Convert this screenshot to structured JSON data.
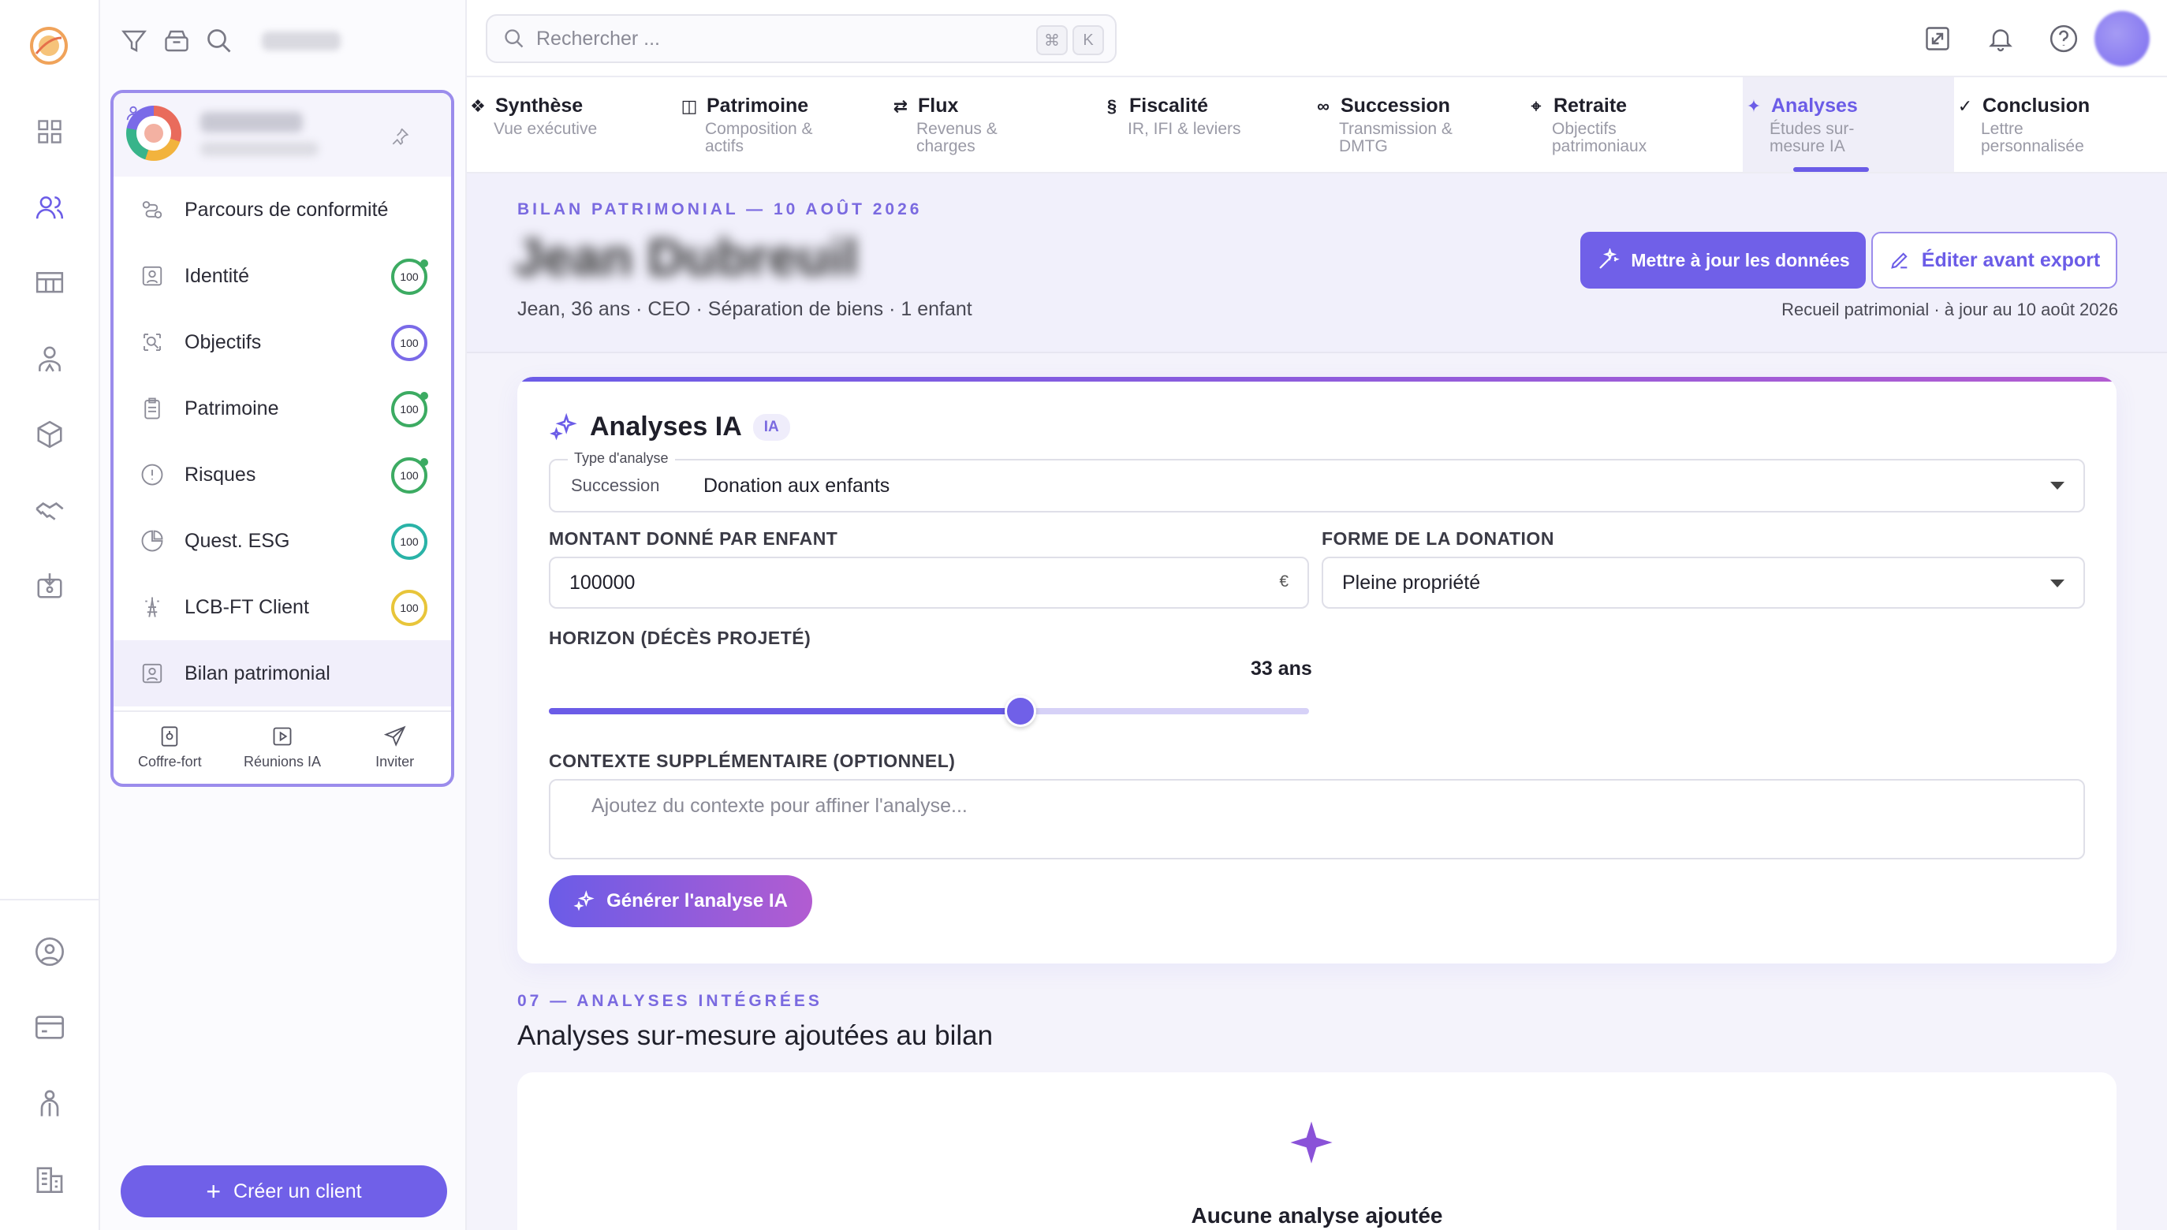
{
  "colors": {
    "accent": "#6b5ce7",
    "accent_gradient_end": "#b25cd1",
    "score_green": "#3cab62",
    "score_purple": "#7a6ae8",
    "score_teal": "#2ab3a7",
    "score_yellow": "#e8c53a"
  },
  "rail": {
    "icons": [
      "app-logo",
      "dashboard-grid-icon",
      "clients-icon",
      "table-icon",
      "advisor-icon",
      "products-cube-icon",
      "handshake-icon",
      "inbox-download-icon",
      "account-circle-icon",
      "billing-card-icon",
      "team-icon",
      "building-icon"
    ],
    "active": "clients-icon"
  },
  "client_panel": {
    "items": [
      {
        "label": "Parcours de conformité",
        "icon": "compliance-route-icon"
      },
      {
        "label": "Identité",
        "icon": "identity-icon",
        "score": "100",
        "score_color": "#3cab62",
        "dot": true
      },
      {
        "label": "Objectifs",
        "icon": "target-icon",
        "score": "100",
        "score_color": "#7a6ae8"
      },
      {
        "label": "Patrimoine",
        "icon": "clipboard-icon",
        "score": "100",
        "score_color": "#3cab62",
        "dot": true
      },
      {
        "label": "Risques",
        "icon": "alert-circle-icon",
        "score": "100",
        "score_color": "#3cab62",
        "dot": true
      },
      {
        "label": "Quest. ESG",
        "icon": "pie-chart-icon",
        "score": "100",
        "score_color": "#2ab3a7"
      },
      {
        "label": "LCB-FT Client",
        "icon": "tower-icon",
        "score": "100",
        "score_color": "#e8c53a"
      },
      {
        "label": "Bilan patrimonial",
        "icon": "report-icon",
        "selected": true
      }
    ],
    "footer": [
      {
        "label": "Coffre-fort",
        "icon": "safe-icon"
      },
      {
        "label": "Réunions IA",
        "icon": "video-play-icon"
      },
      {
        "label": "Inviter",
        "icon": "send-icon"
      }
    ],
    "new_client_label": "Créer un client"
  },
  "topbar": {
    "search_placeholder": "Rechercher ...",
    "kbd_cmd": "⌘",
    "kbd_k": "K"
  },
  "tabs": [
    {
      "title": "Synthèse",
      "sub": "Vue exécutive",
      "icon": "❖"
    },
    {
      "title": "Patrimoine",
      "sub": "Composition & actifs",
      "icon": "◫"
    },
    {
      "title": "Flux",
      "sub": "Revenus & charges",
      "icon": "⇄"
    },
    {
      "title": "Fiscalité",
      "sub": "IR, IFI & leviers",
      "icon": "§"
    },
    {
      "title": "Succession",
      "sub": "Transmission & DMTG",
      "icon": "∞"
    },
    {
      "title": "Retraite",
      "sub": "Objectifs patrimoniaux",
      "icon": "⌖"
    },
    {
      "title": "Analyses",
      "sub": "Études sur-mesure IA",
      "icon": "✦",
      "active": true
    },
    {
      "title": "Conclusion",
      "sub": "Lettre personnalisée",
      "icon": "✓"
    }
  ],
  "header": {
    "eyebrow": "BILAN PATRIMONIAL — 10 AOÛT 2026",
    "client_name": "Jean Dubreuil",
    "meta": "Jean, 36 ans · CEO · Séparation de biens · 1 enfant",
    "update_label": "Mettre à jour les données",
    "edit_label": "Éditer avant export",
    "updated": "Recueil patrimonial · à jour au 10 août 2026"
  },
  "analysis": {
    "title": "Analyses IA",
    "badge": "IA",
    "type_legend": "Type d'analyse",
    "type_category": "Succession",
    "type_value": "Donation aux enfants",
    "amount_label": "MONTANT DONNÉ PAR ENFANT",
    "amount_value": "100000",
    "currency": "€",
    "form_label": "FORME DE LA DONATION",
    "form_value": "Pleine propriété",
    "horizon_label": "HORIZON (DÉCÈS PROJETÉ)",
    "horizon_display": "33 ans",
    "horizon_fraction": 0.62,
    "context_label": "CONTEXTE SUPPLÉMENTAIRE (OPTIONNEL)",
    "context_placeholder": "Ajoutez du contexte pour affiner l'analyse...",
    "generate_label": "Générer l'analyse IA"
  },
  "integrated": {
    "eyebrow": "07 — ANALYSES INTÉGRÉES",
    "title": "Analyses sur-mesure ajoutées au bilan",
    "empty_text": "Aucune analyse ajoutée"
  }
}
